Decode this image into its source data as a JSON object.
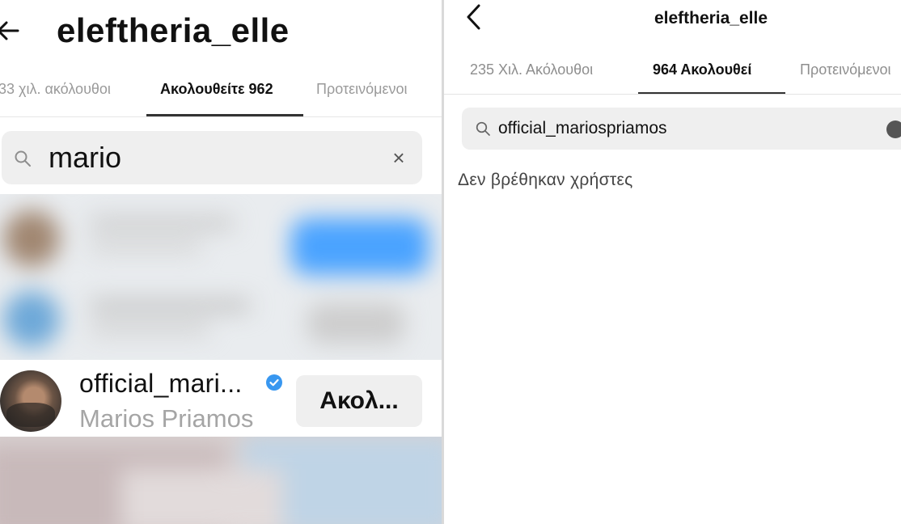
{
  "left_panel": {
    "title": "eleftheria_elle",
    "tabs": [
      {
        "label": "33 χιλ. ακόλουθοι",
        "active": false
      },
      {
        "label": "Ακολουθείτε 962",
        "active": true
      },
      {
        "label": "Προτεινόμενοι",
        "active": false
      }
    ],
    "search": {
      "value": "mario",
      "clear_icon": "×"
    },
    "result": {
      "username": "official_mari...",
      "verified": true,
      "full_name": "Marios Priamos",
      "button_label": "Ακολ..."
    }
  },
  "right_panel": {
    "title": "eleftheria_elle",
    "tabs": [
      {
        "label": "235 Χιλ. Ακόλουθοι",
        "active": false
      },
      {
        "label": "964 Ακολουθεί",
        "active": true
      },
      {
        "label": "Προτεινόμενοι",
        "active": false
      }
    ],
    "search": {
      "value": "official_mariospriamos"
    },
    "empty_message": "Δεν βρέθηκαν χρήστες"
  },
  "colors": {
    "verified_badge": "#3897f0",
    "search_bg": "#efefef",
    "muted_text": "#a5a5a5"
  },
  "icons": [
    "back-arrow-icon",
    "search-icon",
    "close-icon",
    "verified-badge-icon",
    "chevron-left-icon",
    "clear-circle-icon"
  ]
}
